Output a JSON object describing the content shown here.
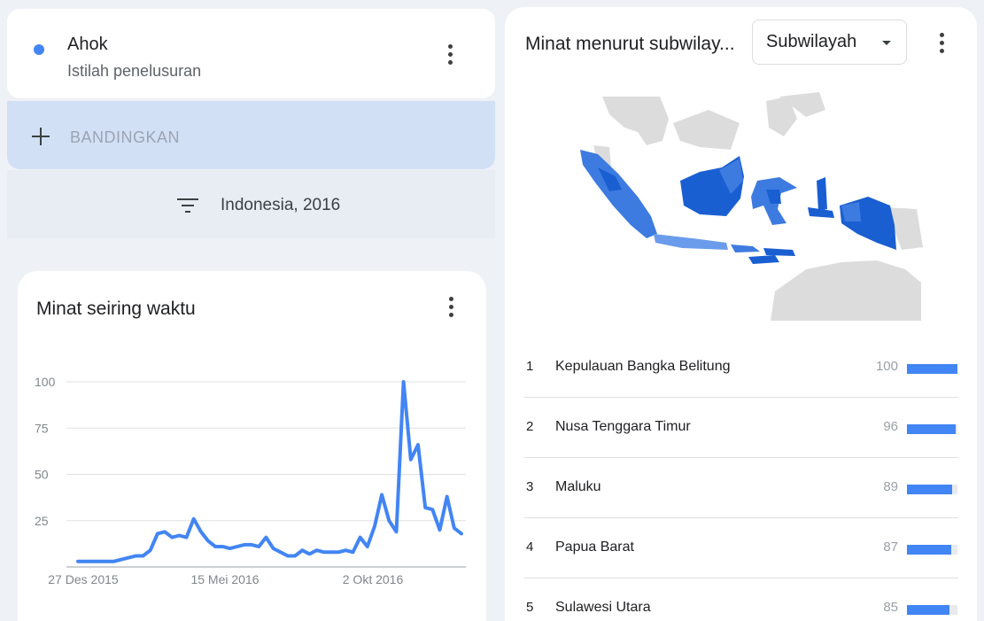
{
  "term": {
    "name": "Ahok",
    "subtitle": "Istilah penelusuran",
    "dot_color": "#4285f4"
  },
  "compare": {
    "label": "BANDINGKAN",
    "icon": "plus-icon"
  },
  "filter": {
    "label": "Indonesia, 2016",
    "icon": "filter-icon"
  },
  "time_card": {
    "title": "Minat seiring waktu",
    "menu_icon": "more-vert-icon"
  },
  "region_card": {
    "title": "Minat menurut subwilay...",
    "select_value": "Subwilayah",
    "menu_icon": "more-vert-icon",
    "regions": [
      {
        "rank": "1",
        "name": "Kepulauan Bangka Belitung",
        "value": "100",
        "level": 100
      },
      {
        "rank": "2",
        "name": "Nusa Tenggara Timur",
        "value": "96",
        "level": 96
      },
      {
        "rank": "3",
        "name": "Maluku",
        "value": "89",
        "level": 89
      },
      {
        "rank": "4",
        "name": "Papua Barat",
        "value": "87",
        "level": 87
      },
      {
        "rank": "5",
        "name": "Sulawesi Utara",
        "value": "85",
        "level": 85
      }
    ]
  },
  "colors": {
    "accent": "#4285f4",
    "map_dark": "#1a5fd1",
    "map_mid": "#3d7be0",
    "map_light": "#6b9cec",
    "map_gray": "#dcdcdc"
  },
  "chart_data": {
    "type": "line",
    "x_ticks": [
      "27 Des 2015",
      "15 Mei 2016",
      "2 Okt 2016"
    ],
    "y_ticks": [
      "25",
      "50",
      "75",
      "100"
    ],
    "ylim": [
      0,
      100
    ],
    "series": [
      {
        "values": [
          3,
          3,
          3,
          3,
          3,
          3,
          4,
          5,
          6,
          6,
          9,
          18,
          19,
          16,
          17,
          16,
          26,
          19,
          14,
          11,
          11,
          10,
          11,
          12,
          12,
          11,
          16,
          10,
          8,
          6,
          6,
          9,
          7,
          9,
          8,
          8,
          8,
          9,
          8,
          16,
          11,
          22,
          39,
          25,
          19,
          100,
          58,
          66,
          32,
          31,
          20,
          38,
          21,
          18
        ]
      }
    ]
  }
}
